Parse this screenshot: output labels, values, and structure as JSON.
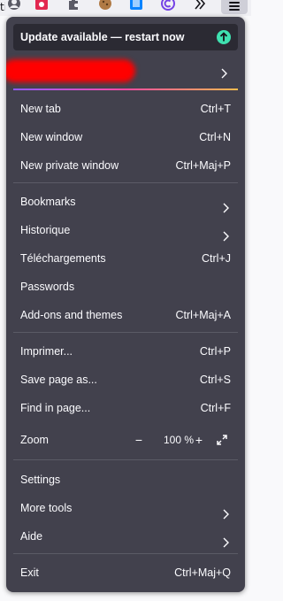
{
  "toolbar": {
    "left_partial_text": "ti",
    "icons": [
      "user-circle-icon",
      "red-extension-icon",
      "puzzle-extension-icon",
      "cookie-extension-icon",
      "blue-extension-icon",
      "c-extension-icon",
      "overflow-chevrons-icon",
      "hamburger-menu-icon"
    ]
  },
  "menu": {
    "update_banner": "Update available — restart now",
    "items": [
      {
        "label": "New tab",
        "shortcut": "Ctrl+T"
      },
      {
        "label": "New window",
        "shortcut": "Ctrl+N"
      },
      {
        "label": "New private window",
        "shortcut": "Ctrl+Maj+P"
      },
      {
        "label": "Bookmarks"
      },
      {
        "label": "Historique"
      },
      {
        "label": "Téléchargements",
        "shortcut": "Ctrl+J"
      },
      {
        "label": "Passwords"
      },
      {
        "label": "Add-ons and themes",
        "shortcut": "Ctrl+Maj+A"
      },
      {
        "label": "Imprimer...",
        "shortcut": "Ctrl+P"
      },
      {
        "label": "Save page as...",
        "shortcut": "Ctrl+S"
      },
      {
        "label": "Find in page...",
        "shortcut": "Ctrl+F"
      },
      {
        "label": "Zoom"
      },
      {
        "label": "Settings"
      },
      {
        "label": "More tools"
      },
      {
        "label": "Aide"
      },
      {
        "label": "Exit",
        "shortcut": "Ctrl+Maj+Q"
      }
    ],
    "zoom": {
      "minus": "−",
      "value": "100 %",
      "plus": "+"
    }
  },
  "colors": {
    "panel_bg": "#42414d",
    "banner_bg": "#2b2a33",
    "update_icon": "#3fe1b0",
    "text": "#fbfbfe",
    "separator": "#5b5b66"
  }
}
